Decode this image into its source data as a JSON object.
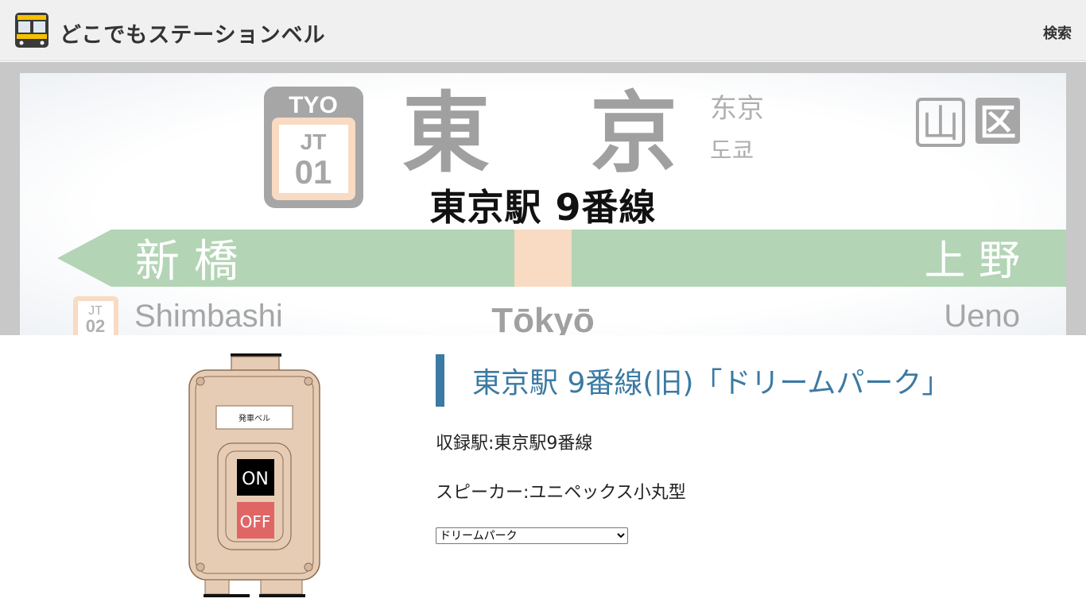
{
  "header": {
    "site_title": "どこでもステーションベル",
    "search_label": "検索"
  },
  "signboard": {
    "station_code": "TYO",
    "line_code": "JT",
    "station_number": "01",
    "station_name_kanji": "東　京",
    "station_name_zh": "东京",
    "station_name_ko": "도쿄",
    "district_marks": [
      "山",
      "区"
    ],
    "prev_station_kanji": "新 橋",
    "next_station_kanji": "上 野",
    "prev_station_romaji": "Shimbashi",
    "station_romaji": "Tōkyō",
    "next_station_romaji": "Ueno",
    "prev_line_code": "JT",
    "prev_station_number": "02"
  },
  "overlay_title": "東京駅 9番線",
  "bell_panel": {
    "label": "発車ベル",
    "on_label": "ON",
    "off_label": "OFF"
  },
  "detail": {
    "title": "東京駅 9番線(旧)「ドリームパーク」",
    "station_line": "収録駅:東京駅9番線",
    "speaker_line": "スピーカー:ユニペックス小丸型",
    "select_value": "ドリームパーク",
    "select_options": [
      "ドリームパーク"
    ]
  },
  "colors": {
    "line_green": "#b3d4b5",
    "accent_orange": "#f8dbc2",
    "title_blue": "#3b7aa3",
    "on_black": "#000000",
    "off_red": "#e06666",
    "bell_body": "#e6ccb4"
  }
}
